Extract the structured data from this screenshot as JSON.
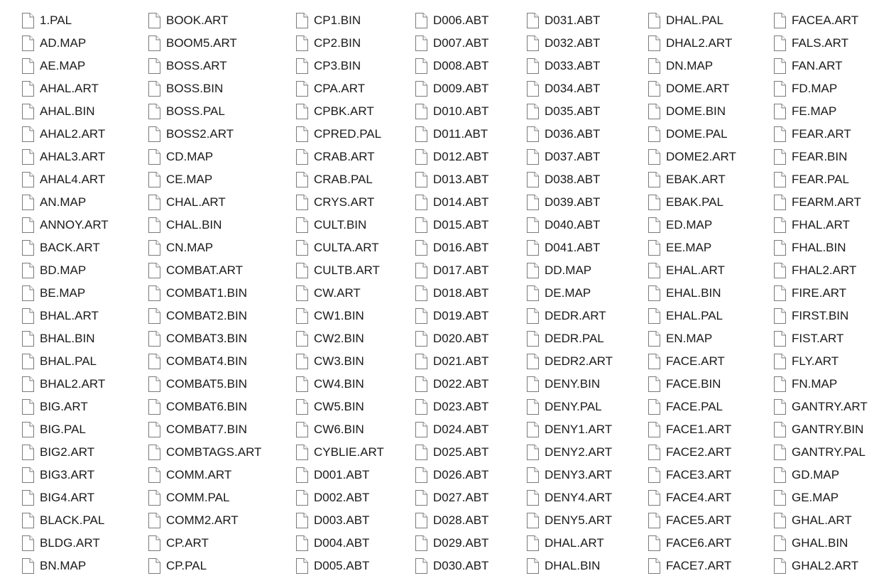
{
  "file_list": {
    "icon": "generic-file-icon",
    "columns": [
      [
        "1.PAL",
        "AD.MAP",
        "AE.MAP",
        "AHAL.ART",
        "AHAL.BIN",
        "AHAL2.ART",
        "AHAL3.ART",
        "AHAL4.ART",
        "AN.MAP",
        "ANNOY.ART",
        "BACK.ART",
        "BD.MAP",
        "BE.MAP",
        "BHAL.ART",
        "BHAL.BIN",
        "BHAL.PAL",
        "BHAL2.ART",
        "BIG.ART",
        "BIG.PAL",
        "BIG2.ART",
        "BIG3.ART",
        "BIG4.ART",
        "BLACK.PAL",
        "BLDG.ART",
        "BN.MAP"
      ],
      [
        "BOOK.ART",
        "BOOM5.ART",
        "BOSS.ART",
        "BOSS.BIN",
        "BOSS.PAL",
        "BOSS2.ART",
        "CD.MAP",
        "CE.MAP",
        "CHAL.ART",
        "CHAL.BIN",
        "CN.MAP",
        "COMBAT.ART",
        "COMBAT1.BIN",
        "COMBAT2.BIN",
        "COMBAT3.BIN",
        "COMBAT4.BIN",
        "COMBAT5.BIN",
        "COMBAT6.BIN",
        "COMBAT7.BIN",
        "COMBTAGS.ART",
        "COMM.ART",
        "COMM.PAL",
        "COMM2.ART",
        "CP.ART",
        "CP.PAL"
      ],
      [
        "CP1.BIN",
        "CP2.BIN",
        "CP3.BIN",
        "CPA.ART",
        "CPBK.ART",
        "CPRED.PAL",
        "CRAB.ART",
        "CRAB.PAL",
        "CRYS.ART",
        "CULT.BIN",
        "CULTA.ART",
        "CULTB.ART",
        "CW.ART",
        "CW1.BIN",
        "CW2.BIN",
        "CW3.BIN",
        "CW4.BIN",
        "CW5.BIN",
        "CW6.BIN",
        "CYBLIE.ART",
        "D001.ABT",
        "D002.ABT",
        "D003.ABT",
        "D004.ABT",
        "D005.ABT"
      ],
      [
        "D006.ABT",
        "D007.ABT",
        "D008.ABT",
        "D009.ABT",
        "D010.ABT",
        "D011.ABT",
        "D012.ABT",
        "D013.ABT",
        "D014.ABT",
        "D015.ABT",
        "D016.ABT",
        "D017.ABT",
        "D018.ABT",
        "D019.ABT",
        "D020.ABT",
        "D021.ABT",
        "D022.ABT",
        "D023.ABT",
        "D024.ABT",
        "D025.ABT",
        "D026.ABT",
        "D027.ABT",
        "D028.ABT",
        "D029.ABT",
        "D030.ABT"
      ],
      [
        "D031.ABT",
        "D032.ABT",
        "D033.ABT",
        "D034.ABT",
        "D035.ABT",
        "D036.ABT",
        "D037.ABT",
        "D038.ABT",
        "D039.ABT",
        "D040.ABT",
        "D041.ABT",
        "DD.MAP",
        "DE.MAP",
        "DEDR.ART",
        "DEDR.PAL",
        "DEDR2.ART",
        "DENY.BIN",
        "DENY.PAL",
        "DENY1.ART",
        "DENY2.ART",
        "DENY3.ART",
        "DENY4.ART",
        "DENY5.ART",
        "DHAL.ART",
        "DHAL.BIN"
      ],
      [
        "DHAL.PAL",
        "DHAL2.ART",
        "DN.MAP",
        "DOME.ART",
        "DOME.BIN",
        "DOME.PAL",
        "DOME2.ART",
        "EBAK.ART",
        "EBAK.PAL",
        "ED.MAP",
        "EE.MAP",
        "EHAL.ART",
        "EHAL.BIN",
        "EHAL.PAL",
        "EN.MAP",
        "FACE.ART",
        "FACE.BIN",
        "FACE.PAL",
        "FACE1.ART",
        "FACE2.ART",
        "FACE3.ART",
        "FACE4.ART",
        "FACE5.ART",
        "FACE6.ART",
        "FACE7.ART"
      ],
      [
        "FACEA.ART",
        "FALS.ART",
        "FAN.ART",
        "FD.MAP",
        "FE.MAP",
        "FEAR.ART",
        "FEAR.BIN",
        "FEAR.PAL",
        "FEARM.ART",
        "FHAL.ART",
        "FHAL.BIN",
        "FHAL2.ART",
        "FIRE.ART",
        "FIRST.BIN",
        "FIST.ART",
        "FLY.ART",
        "FN.MAP",
        "GANTRY.ART",
        "GANTRY.BIN",
        "GANTRY.PAL",
        "GD.MAP",
        "GE.MAP",
        "GHAL.ART",
        "GHAL.BIN",
        "GHAL2.ART"
      ]
    ]
  }
}
